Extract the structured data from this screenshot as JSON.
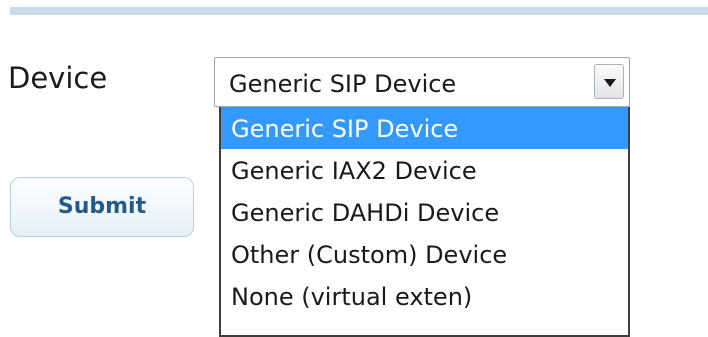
{
  "form": {
    "device_label": "Device",
    "submit_label": "Submit"
  },
  "device_select": {
    "selected_value": "Generic SIP Device",
    "options": [
      "Generic SIP Device",
      "Generic IAX2 Device",
      "Generic DAHDi Device",
      "Other (Custom) Device",
      "None (virtual exten)"
    ],
    "highlighted_option": "Generic SIP Device",
    "arrow_icon": "chevron-down-icon"
  },
  "colors": {
    "highlight": "#3399ff",
    "divider": "#c9dbe9",
    "button_text": "#245a88"
  }
}
